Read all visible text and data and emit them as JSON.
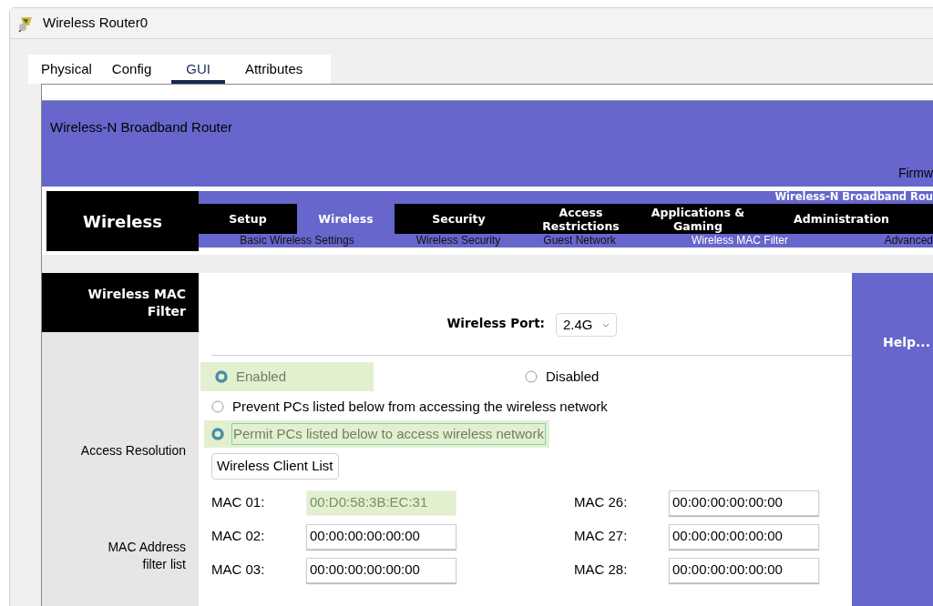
{
  "window": {
    "title": "Wireless Router0"
  },
  "tabs": [
    {
      "label": "Physical",
      "selected": false
    },
    {
      "label": "Config",
      "selected": false
    },
    {
      "label": "GUI",
      "selected": true
    },
    {
      "label": "Attributes",
      "selected": false
    }
  ],
  "router": {
    "title": "Wireless-N Broadband Router",
    "firmware": "Firmw",
    "product": "Wireless-N Broadband Rou",
    "section": "Wireless",
    "menu": [
      {
        "label": "Setup",
        "selected": false
      },
      {
        "label": "Wireless",
        "selected": true
      },
      {
        "label": "Security",
        "selected": false
      },
      {
        "label": "Access Restrictions",
        "selected": false
      },
      {
        "label": "Applications & Gaming",
        "selected": false
      },
      {
        "label": "Administration",
        "selected": false
      }
    ],
    "submenu": [
      {
        "label": "Basic Wireless Settings",
        "selected": false
      },
      {
        "label": "Wireless Security",
        "selected": false
      },
      {
        "label": "Guest Network",
        "selected": false
      },
      {
        "label": "Wireless MAC Filter",
        "selected": true
      },
      {
        "label": "Advanced",
        "selected": false
      }
    ]
  },
  "panel": {
    "title": "Wireless MAC Filter",
    "help": "Help...",
    "port": {
      "label": "Wireless Port:",
      "value": "2.4G"
    },
    "access_resolution": "Access Resolution",
    "status": [
      {
        "label": "Enabled",
        "selected": true,
        "highlighted": true
      },
      {
        "label": "Disabled",
        "selected": false,
        "highlighted": false
      }
    ],
    "policy": [
      {
        "label": "Prevent PCs listed below from accessing the wireless network",
        "selected": false,
        "highlighted": false
      },
      {
        "label": "Permit PCs listed below to access wireless network",
        "selected": true,
        "highlighted": true
      }
    ],
    "client_list_button": "Wireless Client List",
    "mac_list_label": "MAC Address filter list",
    "macs": [
      {
        "label": "MAC 01:",
        "value": "00:D0:58:3B:EC:31",
        "highlighted": true
      },
      {
        "label": "MAC 26:",
        "value": "00:00:00:00:00:00",
        "highlighted": false
      },
      {
        "label": "MAC 02:",
        "value": "00:00:00:00:00:00",
        "highlighted": false
      },
      {
        "label": "MAC 27:",
        "value": "00:00:00:00:00:00",
        "highlighted": false
      },
      {
        "label": "MAC 03:",
        "value": "00:00:00:00:00:00",
        "highlighted": false
      },
      {
        "label": "MAC 28:",
        "value": "00:00:00:00:00:00",
        "highlighted": false
      }
    ]
  }
}
